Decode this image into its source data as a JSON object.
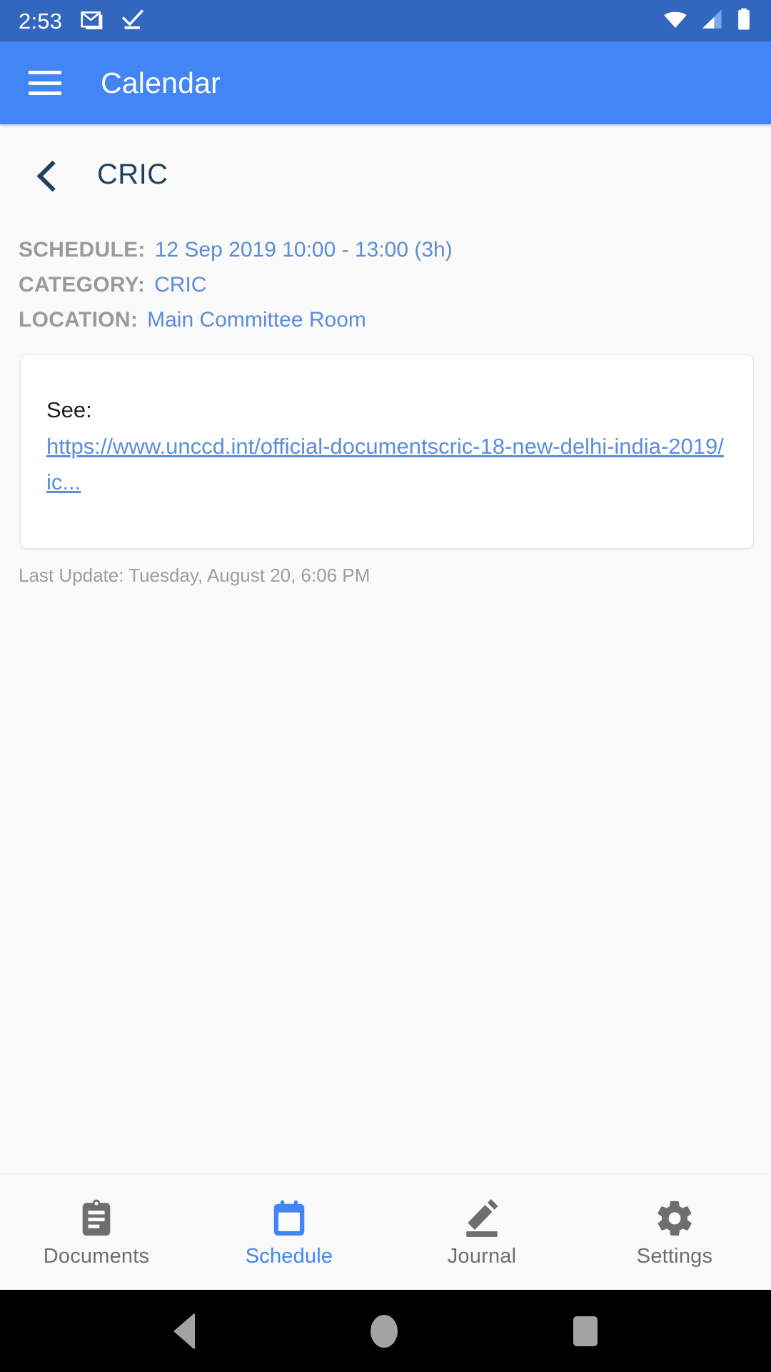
{
  "status_bar": {
    "time": "2:53",
    "left_icons": [
      "gmail-icon",
      "tasks-check-icon"
    ],
    "right_icons": [
      "wifi-icon",
      "cellular-signal-icon",
      "battery-icon"
    ],
    "background_color": "#3367BE"
  },
  "app_bar": {
    "menu_icon": "hamburger-menu-icon",
    "title": "Calendar",
    "background_color": "#4285F4"
  },
  "sub_header": {
    "back_icon": "back-chevron-icon",
    "title": "CRIC",
    "title_color": "#20415F"
  },
  "details": {
    "rows": [
      {
        "label": "SCHEDULE:",
        "value": "12 Sep 2019 10:00 - 13:00 (3h)"
      },
      {
        "label": "CATEGORY:",
        "value": "CRIC"
      },
      {
        "label": "LOCATION:",
        "value": "Main Committee Room"
      }
    ],
    "label_color": "#9A9A9A",
    "value_color": "#5B8DD9"
  },
  "description_card": {
    "text": "See:",
    "link_text": "https://www.unccd.int/official-documentscric-18-new-delhi-india-2019/ic...",
    "link_color": "#5B8DD9"
  },
  "last_update": "Last Update: Tuesday, August 20, 6:06 PM",
  "bottom_nav": {
    "active_color": "#4285F4",
    "inactive_color": "#6E6E6E",
    "items": [
      {
        "label": "Documents",
        "icon": "clipboard-icon",
        "active": false
      },
      {
        "label": "Schedule",
        "icon": "calendar-icon",
        "active": true
      },
      {
        "label": "Journal",
        "icon": "pencil-edit-icon",
        "active": false
      },
      {
        "label": "Settings",
        "icon": "gear-icon",
        "active": false
      }
    ]
  },
  "android_nav": {
    "back": "android-back-icon",
    "home": "android-home-icon",
    "recents": "android-recents-icon"
  }
}
